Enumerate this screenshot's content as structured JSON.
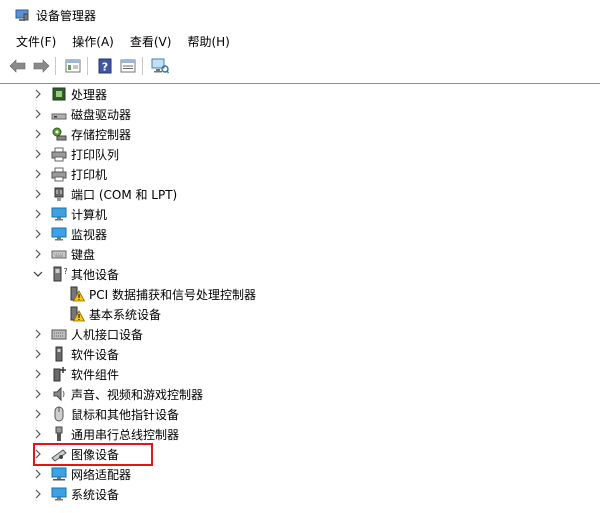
{
  "window": {
    "title": "设备管理器",
    "icon": "device-manager-icon"
  },
  "menu": [
    "文件(F)",
    "操作(A)",
    "查看(V)",
    "帮助(H)"
  ],
  "toolbar": [
    {
      "name": "back-button",
      "icon": "arrow-left-icon"
    },
    {
      "name": "forward-button",
      "icon": "arrow-right-icon"
    },
    {
      "name": "show-hide-console-tree-button",
      "icon": "console-tree-icon"
    },
    {
      "name": "help-button",
      "icon": "help-icon"
    },
    {
      "name": "properties-button",
      "icon": "properties-icon"
    },
    {
      "name": "scan-hardware-button",
      "icon": "scan-hardware-icon"
    }
  ],
  "tree": {
    "items": [
      {
        "label": "处理器",
        "icon": "processor-icon",
        "state": "collapsed"
      },
      {
        "label": "磁盘驱动器",
        "icon": "disk-drive-icon",
        "state": "collapsed"
      },
      {
        "label": "存储控制器",
        "icon": "storage-controller-icon",
        "state": "collapsed"
      },
      {
        "label": "打印队列",
        "icon": "print-queue-icon",
        "state": "collapsed"
      },
      {
        "label": "打印机",
        "icon": "printer-icon",
        "state": "collapsed"
      },
      {
        "label": "端口 (COM 和 LPT)",
        "icon": "port-icon",
        "state": "collapsed"
      },
      {
        "label": "计算机",
        "icon": "computer-icon",
        "state": "collapsed"
      },
      {
        "label": "监视器",
        "icon": "monitor-icon",
        "state": "collapsed"
      },
      {
        "label": "键盘",
        "icon": "keyboard-icon",
        "state": "collapsed"
      },
      {
        "label": "其他设备",
        "icon": "other-devices-icon",
        "state": "expanded"
      },
      {
        "label": "PCI 数据捕获和信号处理控制器",
        "icon": "warning-device-icon",
        "state": "child"
      },
      {
        "label": "基本系统设备",
        "icon": "warning-device-icon",
        "state": "child"
      },
      {
        "label": "人机接口设备",
        "icon": "hid-icon",
        "state": "collapsed"
      },
      {
        "label": "软件设备",
        "icon": "software-device-icon",
        "state": "collapsed"
      },
      {
        "label": "软件组件",
        "icon": "software-component-icon",
        "state": "collapsed"
      },
      {
        "label": "声音、视频和游戏控制器",
        "icon": "sound-icon",
        "state": "collapsed"
      },
      {
        "label": "鼠标和其他指针设备",
        "icon": "mouse-icon",
        "state": "collapsed"
      },
      {
        "label": "通用串行总线控制器",
        "icon": "usb-icon",
        "state": "collapsed"
      },
      {
        "label": "图像设备",
        "icon": "camera-icon",
        "state": "collapsed",
        "highlighted": true
      },
      {
        "label": "网络适配器",
        "icon": "network-adapter-icon",
        "state": "collapsed"
      },
      {
        "label": "系统设备",
        "icon": "system-device-icon",
        "state": "collapsed"
      }
    ]
  },
  "colors": {
    "highlight_border": "#e3141a",
    "accent": "#1e7fd6"
  }
}
